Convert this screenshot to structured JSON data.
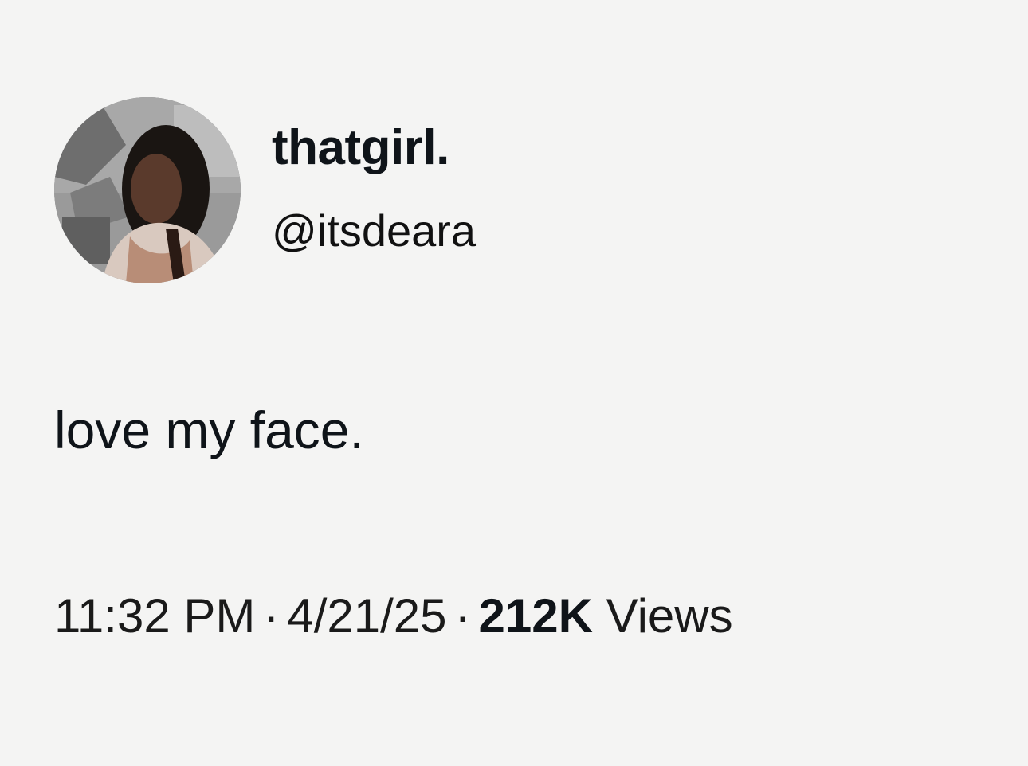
{
  "tweet": {
    "author": {
      "display_name": "thatgirl.",
      "handle": "@itsdeara",
      "avatar_icon": "profile-photo"
    },
    "text": "love my face.",
    "meta": {
      "time": "11:32 PM",
      "separator": "·",
      "date": "4/21/25",
      "views_count": "212K",
      "views_label": "Views"
    }
  },
  "colors": {
    "background": "#f4f4f3",
    "text": "#0f1419"
  }
}
